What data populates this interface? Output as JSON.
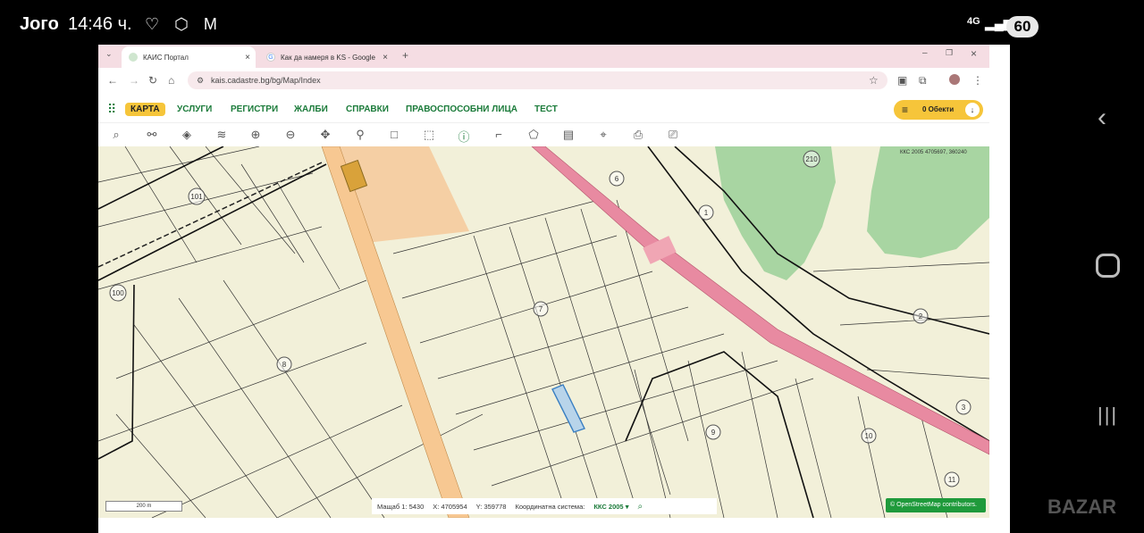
{
  "status": {
    "carrier": "Joгo",
    "time": "14:46 ч.",
    "net": "4G",
    "battery": "60"
  },
  "browser": {
    "tabs": [
      {
        "label": "КАИС Портал",
        "active": true
      },
      {
        "label": "Как да намеря в KS - Google",
        "active": false
      }
    ],
    "url": "kais.cadastre.bg/bg/Map/Index"
  },
  "site": {
    "menu": [
      "КАРТА",
      "УСЛУГИ",
      "РЕГИСТРИ",
      "ЖАЛБИ",
      "СПРАВКИ",
      "ПРАВОСПОСОБНИ ЛИЦА",
      "ТЕСТ"
    ],
    "objects": "0 Обекти"
  },
  "map": {
    "coords_top": "ККС 2005 4705697, 360240",
    "labels": [
      "210",
      "101",
      "6",
      "1",
      "100",
      "7",
      "8",
      "2",
      "9",
      "10",
      "3",
      "11"
    ],
    "scale_label": "Мащаб 1:",
    "scale": "5430",
    "x_label": "X:",
    "x": "4705954",
    "y_label": "Y:",
    "y": "359778",
    "cs_label": "Координатна система:",
    "cs": "ККС 2005",
    "scalebar": "200 m",
    "osm": "© OpenStreetMap contributors."
  }
}
